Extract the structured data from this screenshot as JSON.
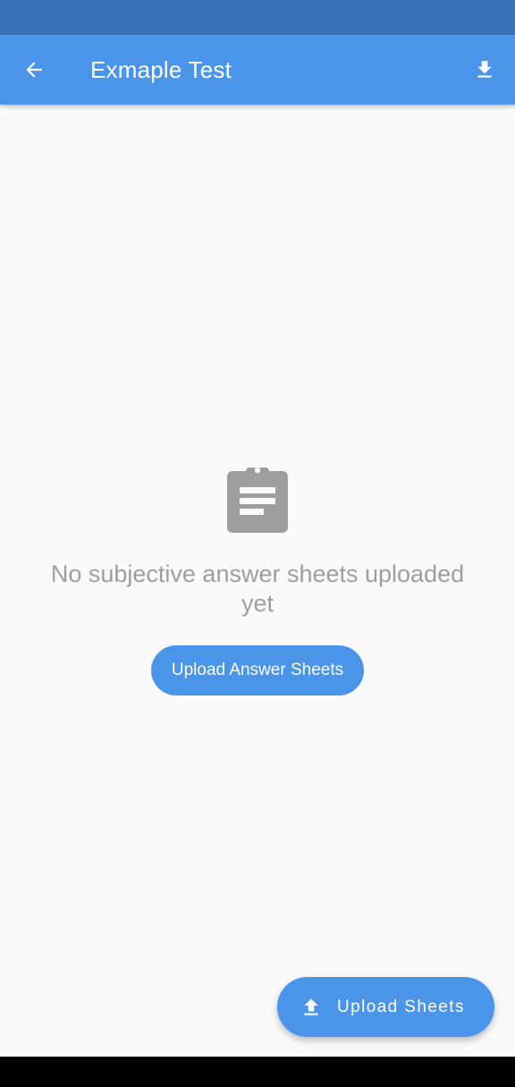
{
  "app_bar": {
    "title": "Exmaple Test",
    "back_icon": "arrow-back-icon",
    "download_icon": "download-icon",
    "color": "#4a94ea"
  },
  "status_bar": {
    "color": "#3a72b8"
  },
  "empty_state": {
    "icon": "clipboard-icon",
    "message": "No subjective answer sheets uploaded yet",
    "button_label": "Upload Answer Sheets"
  },
  "fab": {
    "icon": "upload-icon",
    "label": "Upload Sheets"
  }
}
